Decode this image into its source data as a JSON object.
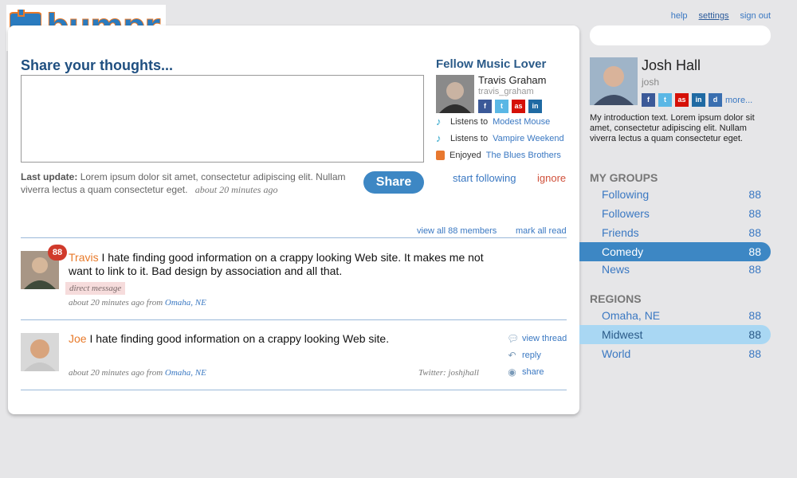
{
  "brand": {
    "name": "bumpr",
    "colors": {
      "blue": "#2a7bbf",
      "orange": "#e87a2a"
    }
  },
  "topnav": {
    "help": "help",
    "settings": "settings",
    "signout": "sign out"
  },
  "search": {
    "placeholder": ""
  },
  "share": {
    "title": "Share your thoughts...",
    "button": "Share",
    "last_update_label": "Last update:",
    "last_update_text": "Lorem ipsum dolor sit amet, consectetur adipiscing elit. Nullam viverra lectus a quam consectetur eget.",
    "last_update_time": "about 20 minutes ago"
  },
  "fellow": {
    "title": "Fellow Music Lover",
    "name": "Travis Graham",
    "handle": "travis_graham",
    "listen1_prefix": "Listens to",
    "listen1_link": "Modest Mouse",
    "listen2_prefix": "Listens to",
    "listen2_link": "Vampire Weekend",
    "enjoyed_prefix": "Enjoyed",
    "enjoyed_link": "The Blues Brothers",
    "follow": "start following",
    "ignore": "ignore"
  },
  "feed": {
    "view_all": "view all 88 members",
    "mark_read": "mark all read",
    "posts": [
      {
        "author": "Travis",
        "text": "I hate finding good information on a crappy looking Web site. It makes me not want to link to it. Bad design by association and all that.",
        "badge": "88",
        "tag": "direct message",
        "time": "about 20 minutes ago from",
        "location": "Omaha, NE"
      },
      {
        "author": "Joe",
        "text": "I hate finding good information on a crappy looking Web site.",
        "time": "about 20 minutes ago from",
        "location": "Omaha, NE",
        "source": "Twitter: joshjhall",
        "actions": {
          "view_thread": "view thread",
          "reply": "reply",
          "share": "share"
        }
      }
    ]
  },
  "profile": {
    "name": "Josh Hall",
    "handle": "josh",
    "more": "more...",
    "intro": "My introduction text. Lorem ipsum dolor sit amet, consectetur adipiscing elit. Nullam viverra lectus a quam consectetur eget."
  },
  "groups": {
    "title": "MY GROUPS",
    "items": [
      {
        "label": "Following",
        "count": "88"
      },
      {
        "label": "Followers",
        "count": "88"
      },
      {
        "label": "Friends",
        "count": "88"
      },
      {
        "label": "Comedy",
        "count": "88"
      },
      {
        "label": "News",
        "count": "88"
      }
    ]
  },
  "regions": {
    "title": "REGIONS",
    "items": [
      {
        "label": "Omaha, NE",
        "count": "88"
      },
      {
        "label": "Midwest",
        "count": "88"
      },
      {
        "label": "World",
        "count": "88"
      }
    ]
  }
}
